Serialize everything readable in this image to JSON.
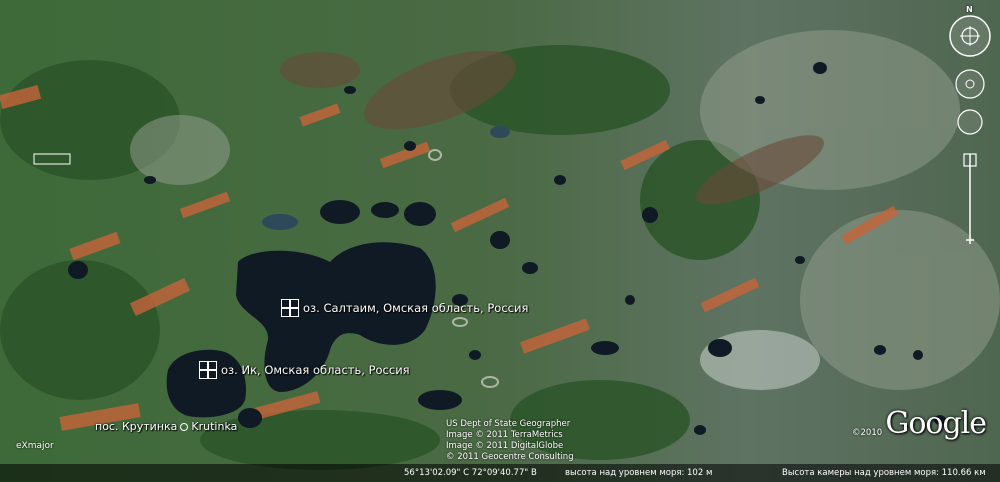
{
  "placemarks": [
    {
      "id": "saltaim",
      "label": "оз. Салтаим, Омская область, Россия"
    },
    {
      "id": "ik",
      "label": "оз. Ик, Омская область, Россия"
    }
  ],
  "towns": [
    {
      "label": "пос. Крутинка"
    },
    {
      "label": "Krutinka"
    }
  ],
  "credits": [
    "US Dept of State Geographer",
    "Image © 2011 TerraMetrics",
    "Image © 2011 DigitalGlobe",
    "© 2011 Geocentre Consulting"
  ],
  "logo": "Google",
  "copyright": "©2010",
  "watermark": "eXmajor",
  "statusbar": {
    "coords": "56°13'02.09\" С  72°09'40.77\" В",
    "elevation": "высота над уровнем моря:  102 м",
    "eye_alt": "Высота камеры над уровнем моря:  110.66 км"
  },
  "compass_north": "N",
  "colors": {
    "water": "#0f1a24",
    "forest": "#2f5a2e",
    "field": "#c0673a",
    "steppe": "#7f8a78"
  }
}
